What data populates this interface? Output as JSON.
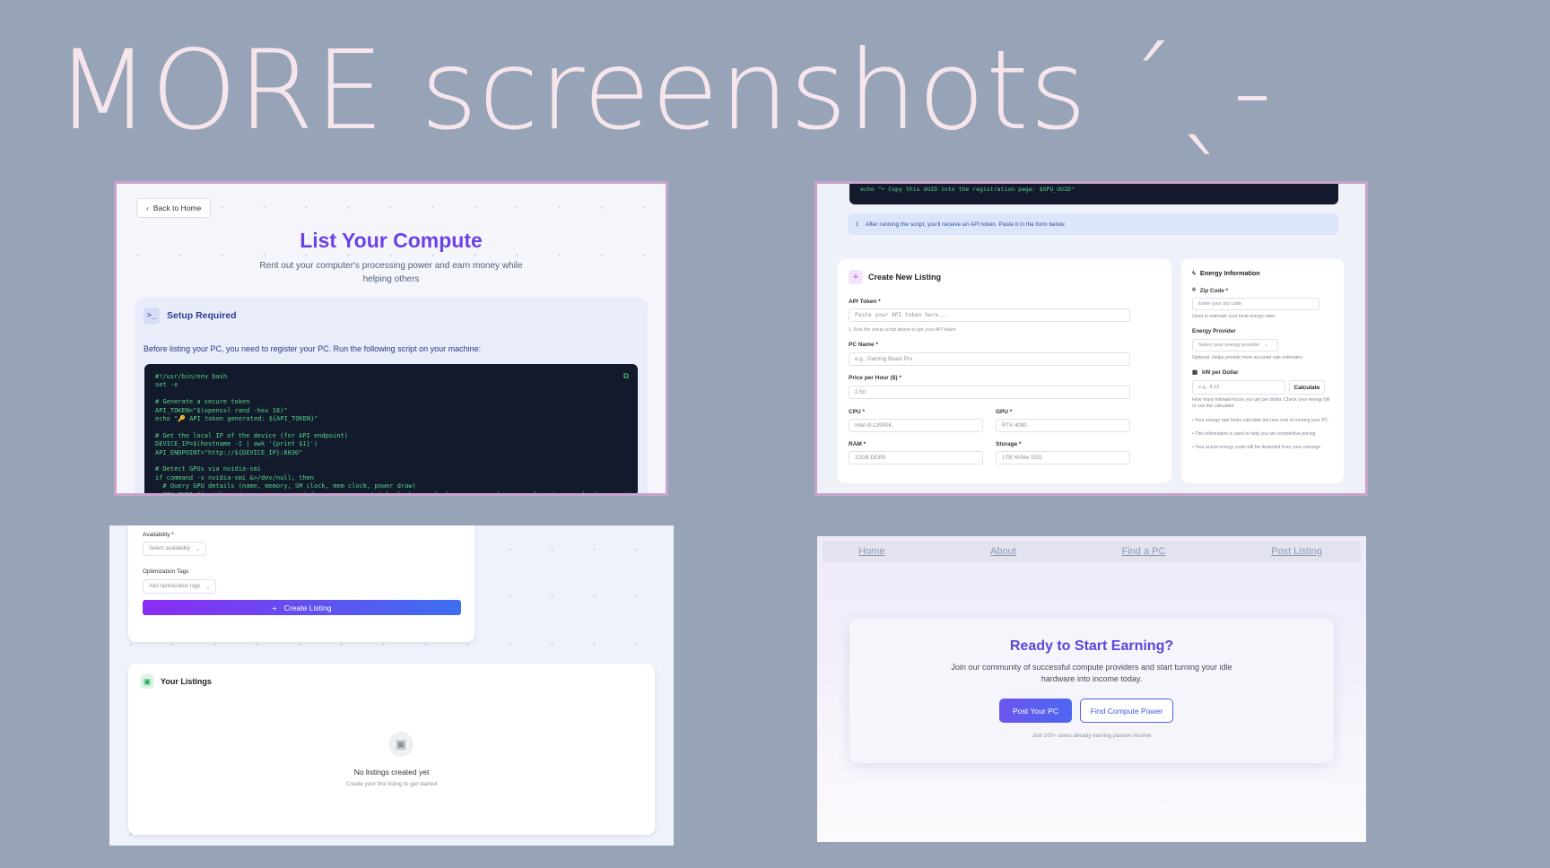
{
  "headline": "MORE screenshots ˊˎ-",
  "panel1": {
    "back_label": "Back to Home",
    "title": "List Your Compute",
    "subtitle": "Rent out your computer's processing power and earn money while helping others",
    "setup_title": "Setup Required",
    "setup_desc": "Before listing your PC, you need to register your PC. Run the following script on your machine:",
    "code_lines": [
      "#!/usr/bin/env bash",
      "set -e",
      "",
      "# Generate a secure token",
      "API_TOKEN=\"$(openssl rand -hex 16)\"",
      "echo \"🔑 API token generated: ${API_TOKEN}\"",
      "",
      "# Get the local IP of the device (for API endpoint)",
      "DEVICE_IP=$(hostname -I | awk '{print $1}')",
      "API_ENDPOINT=\"http://${DEVICE_IP}:8030\"",
      "",
      "# Detect GPUs via nvidia-smi",
      "if command -v nvidia-smi &>/dev/null; then",
      "  # Query GPU details (name, memory, SM clock, mem clock, power draw)",
      "  GPU_INFO=$(nvidia-smi    --query-gpu=index,name,memory.total,clocks.sm,clocks.mem,power.draw    --format=csv,noheader,nounits)"
    ]
  },
  "panel2": {
    "code_tail": "echo \"• Copy this UUID into the registration page: $GPU_UUID\"",
    "info_text": "After running the script, you'll receive an API token. Paste it in the form below.",
    "create_title": "Create New Listing",
    "api_token_label": "API Token *",
    "api_token_placeholder": "Paste your API token here...",
    "api_token_hint": "1. Run the setup script above to get your API token",
    "pc_name_label": "PC Name *",
    "pc_name_placeholder": "e.g., Gaming Beast Pro",
    "price_label": "Price per Hour ($) *",
    "price_value": "2.50",
    "cpu_label": "CPU *",
    "cpu_value": "Intel i9-13900K",
    "gpu_label": "GPU *",
    "gpu_value": "RTX 4090",
    "ram_label": "RAM *",
    "ram_value": "32GB DDR5",
    "storage_label": "Storage *",
    "storage_value": "1TB NVMe SSD",
    "energy": {
      "title": "Energy Information",
      "zip_label": "Zip Code *",
      "zip_placeholder": "Enter your zip code",
      "zip_hint": "Used to estimate your local energy rates",
      "provider_label": "Energy Provider",
      "provider_placeholder": "Select your energy provider",
      "provider_hint": "Optional. Helps provide more accurate rate estimates",
      "kw_label": "kW per Dollar",
      "kw_placeholder": "e.g., 9.15",
      "calc_label": "Calculate",
      "kw_hint": "How many kilowatt-hours you get per dollar. Check your energy bill or use the calculator.",
      "note1": "• Your energy rate helps calculate the true cost of running your PC",
      "note2": "• This information is used to help you set competitive pricing",
      "note3": "• Your actual energy costs will be deducted from your earnings"
    }
  },
  "panel3": {
    "availability_label": "Availability *",
    "availability_placeholder": "Select availability",
    "tags_label": "Optimization Tags",
    "tags_placeholder": "Add optimization tags",
    "create_label": "Create Listing",
    "listings_title": "Your Listings",
    "empty_title": "No listings created yet",
    "empty_sub": "Create your first listing to get started"
  },
  "panel4": {
    "nav": [
      "Home",
      "About",
      "Find a PC",
      "Post Listing"
    ],
    "cta_title": "Ready to Start Earning?",
    "cta_sub": "Join our community of successful compute providers and start turning your idle hardware into income today.",
    "post_label": "Post Your PC",
    "find_label": "Find Compute Power",
    "footnote": "Join 100+ users already earning passive income"
  }
}
